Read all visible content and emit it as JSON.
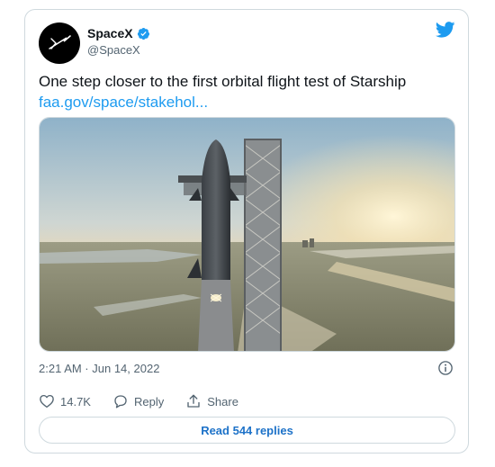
{
  "tweet": {
    "display_name": "SpaceX",
    "handle": "@SpaceX",
    "text": "One step closer to the first orbital flight test of Starship",
    "link_text": "faa.gov/space/stakehol...",
    "timestamp": "2:21 AM · Jun 14, 2022",
    "media_description": "Starship on orbital launch tower at sunrise",
    "verified": true
  },
  "actions": {
    "like_count": "14.7K",
    "reply_label": "Reply",
    "share_label": "Share"
  },
  "replies_button": {
    "label": "Read 544 replies"
  },
  "colors": {
    "brand_blue": "#1d9bf0",
    "text_primary": "#0f1419",
    "text_secondary": "#536471",
    "border": "#cfd9de"
  },
  "icons": {
    "avatar": "spacex-logo-icon",
    "verified": "verified-badge-icon",
    "brand": "twitter-bird-icon",
    "info": "info-icon",
    "like": "heart-icon",
    "reply": "reply-bubble-icon",
    "share": "share-upload-icon"
  }
}
